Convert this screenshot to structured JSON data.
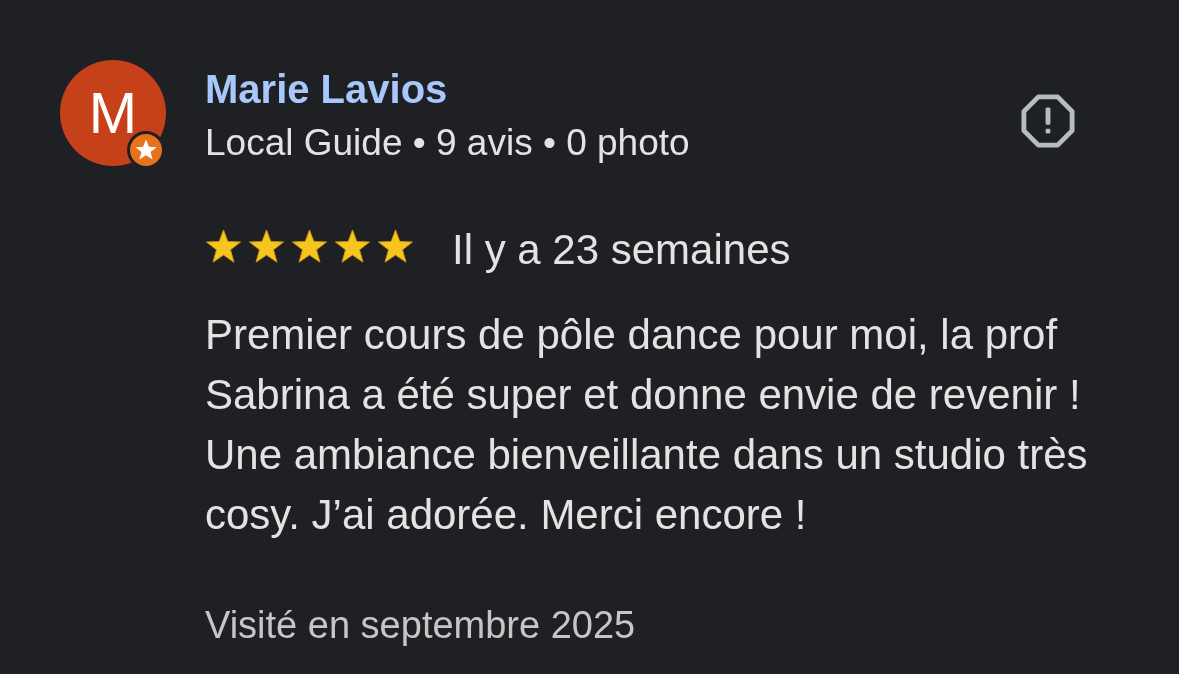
{
  "review": {
    "avatar": {
      "initial": "M",
      "local_guide": true
    },
    "author": "Marie Lavios",
    "meta": "Local Guide • 9 avis • 0 photo",
    "stars": 5,
    "time": "Il y a 23 semaines",
    "text": "Premier cours de pôle dance pour moi, la prof Sabrina a été super et donne envie de revenir ! Une ambiance bienveillante dans un studio très cosy. J’ai adorée. Merci encore !",
    "visited": "Visité en septembre 2025"
  }
}
